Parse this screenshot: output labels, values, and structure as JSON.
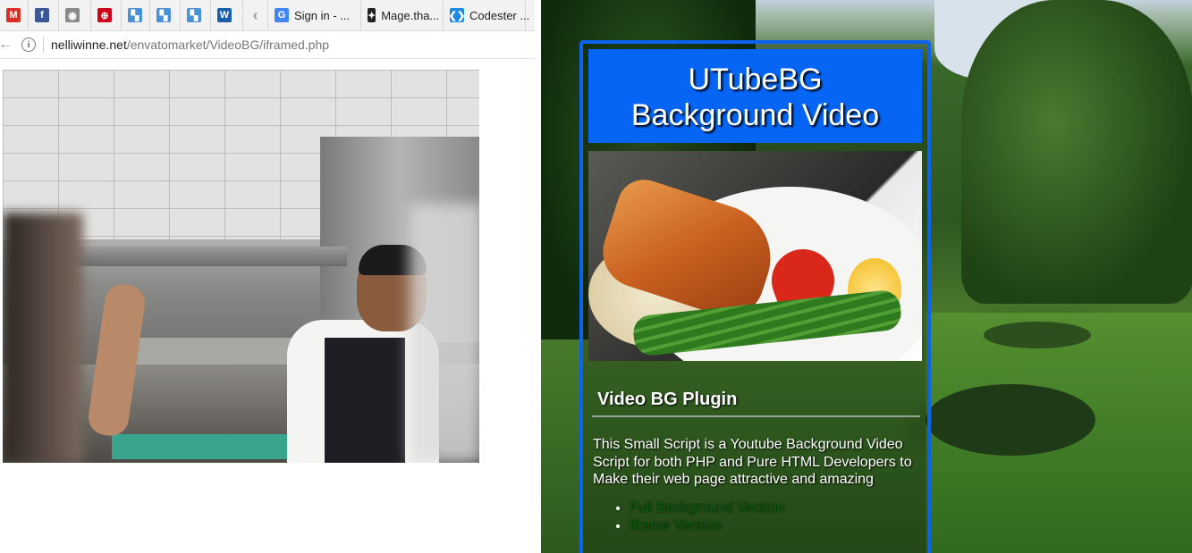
{
  "browser": {
    "bookmarks": [
      {
        "icon": "gmail-icon",
        "label": "",
        "color": "#d93025",
        "glyph": "M"
      },
      {
        "icon": "facebook-icon",
        "label": "",
        "color": "#3b5998",
        "glyph": "f"
      },
      {
        "icon": "globe-icon",
        "label": "",
        "color": "#8a8a8a",
        "glyph": "◉"
      },
      {
        "icon": "shield-icon",
        "label": "",
        "color": "#d0021b",
        "glyph": "⊕"
      },
      {
        "icon": "puzzle-icon",
        "label": "",
        "color": "#4a90d9",
        "glyph": "▚"
      },
      {
        "icon": "puzzle-icon",
        "label": "",
        "color": "#4a90d9",
        "glyph": "▚"
      },
      {
        "icon": "puzzle-icon",
        "label": "",
        "color": "#4a90d9",
        "glyph": "▚"
      },
      {
        "icon": "wave-icon",
        "label": "",
        "color": "#1b5fa8",
        "glyph": "W"
      },
      {
        "icon": "chevron-left-icon",
        "label": "",
        "color": "#9a9a9a",
        "glyph": "‹"
      },
      {
        "icon": "google-icon",
        "label": "Sign in - ...",
        "color": "#4285f4",
        "glyph": "G"
      },
      {
        "icon": "bee-icon",
        "label": "Mage.tha...",
        "color": "#222222",
        "glyph": "✦"
      },
      {
        "icon": "codester-icon",
        "label": "Codester ...",
        "color": "#1e88e5",
        "glyph": "❮❯"
      }
    ],
    "address": {
      "domain": "nelliwinne.net",
      "path": "/envatomarket/VideoBG/iframed.php"
    }
  },
  "card": {
    "title_line1": "UTubeBG",
    "title_line2": "Background Video",
    "subtitle": "Video BG Plugin",
    "description": "This Small Script is a Youtube Background Video Script for both PHP and Pure HTML Developers to Make their web page attractive and amazing",
    "links": [
      "Full Background Version",
      "Iframe Version"
    ]
  },
  "colors": {
    "card_blue": "#0765f6",
    "link_green": "#0b5e0b"
  }
}
